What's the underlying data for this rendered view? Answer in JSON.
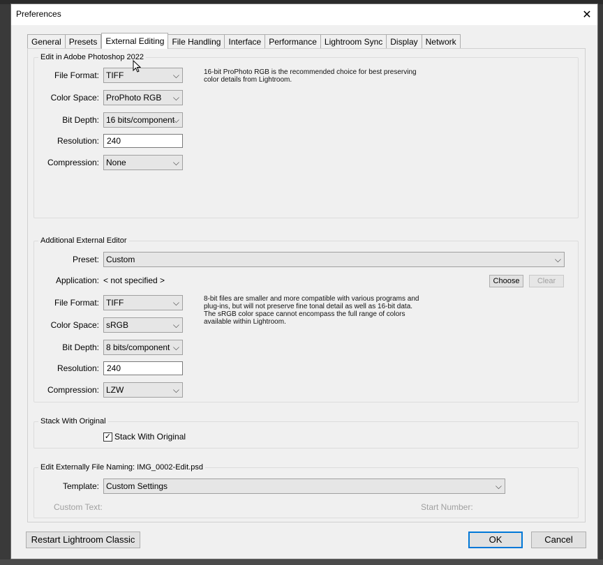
{
  "dialog": {
    "title": "Preferences"
  },
  "tabs": [
    "General",
    "Presets",
    "External Editing",
    "File Handling",
    "Interface",
    "Performance",
    "Lightroom Sync",
    "Display",
    "Network"
  ],
  "active_tab": "External Editing",
  "photoshop": {
    "group_title": "Edit in Adobe Photoshop 2022",
    "file_format_label": "File Format:",
    "file_format": "TIFF",
    "color_space_label": "Color Space:",
    "color_space": "ProPhoto RGB",
    "bit_depth_label": "Bit Depth:",
    "bit_depth": "16 bits/component",
    "resolution_label": "Resolution:",
    "resolution": "240",
    "compression_label": "Compression:",
    "compression": "None",
    "note_line1": "16-bit ProPhoto RGB is the recommended choice for best preserving",
    "note_line2": "color details from Lightroom."
  },
  "additional": {
    "group_title": "Additional External Editor",
    "preset_label": "Preset:",
    "preset": "Custom",
    "application_label": "Application:",
    "application": "< not specified >",
    "choose_label": "Choose",
    "clear_label": "Clear",
    "file_format_label": "File Format:",
    "file_format": "TIFF",
    "color_space_label": "Color Space:",
    "color_space": "sRGB",
    "bit_depth_label": "Bit Depth:",
    "bit_depth": "8 bits/component",
    "resolution_label": "Resolution:",
    "resolution": "240",
    "compression_label": "Compression:",
    "compression": "LZW",
    "note_line1": "8-bit files are smaller and more compatible with various programs and",
    "note_line2": "plug-ins, but will not preserve fine tonal detail as well as 16-bit data.",
    "note_line3": "The sRGB color space cannot encompass the full range of colors",
    "note_line4": "available within Lightroom."
  },
  "stack": {
    "group_title": "Stack With Original",
    "checkbox_label": "Stack With Original",
    "checked_mark": "✓"
  },
  "naming": {
    "group_title": "Edit Externally File Naming:  IMG_0002-Edit.psd",
    "template_label": "Template:",
    "template": "Custom Settings",
    "custom_text_label": "Custom Text:",
    "start_number_label": "Start Number:"
  },
  "footer": {
    "restart_label": "Restart Lightroom Classic",
    "ok_label": "OK",
    "cancel_label": "Cancel"
  },
  "icons": {
    "close": "✕",
    "chevron": "⌵"
  }
}
